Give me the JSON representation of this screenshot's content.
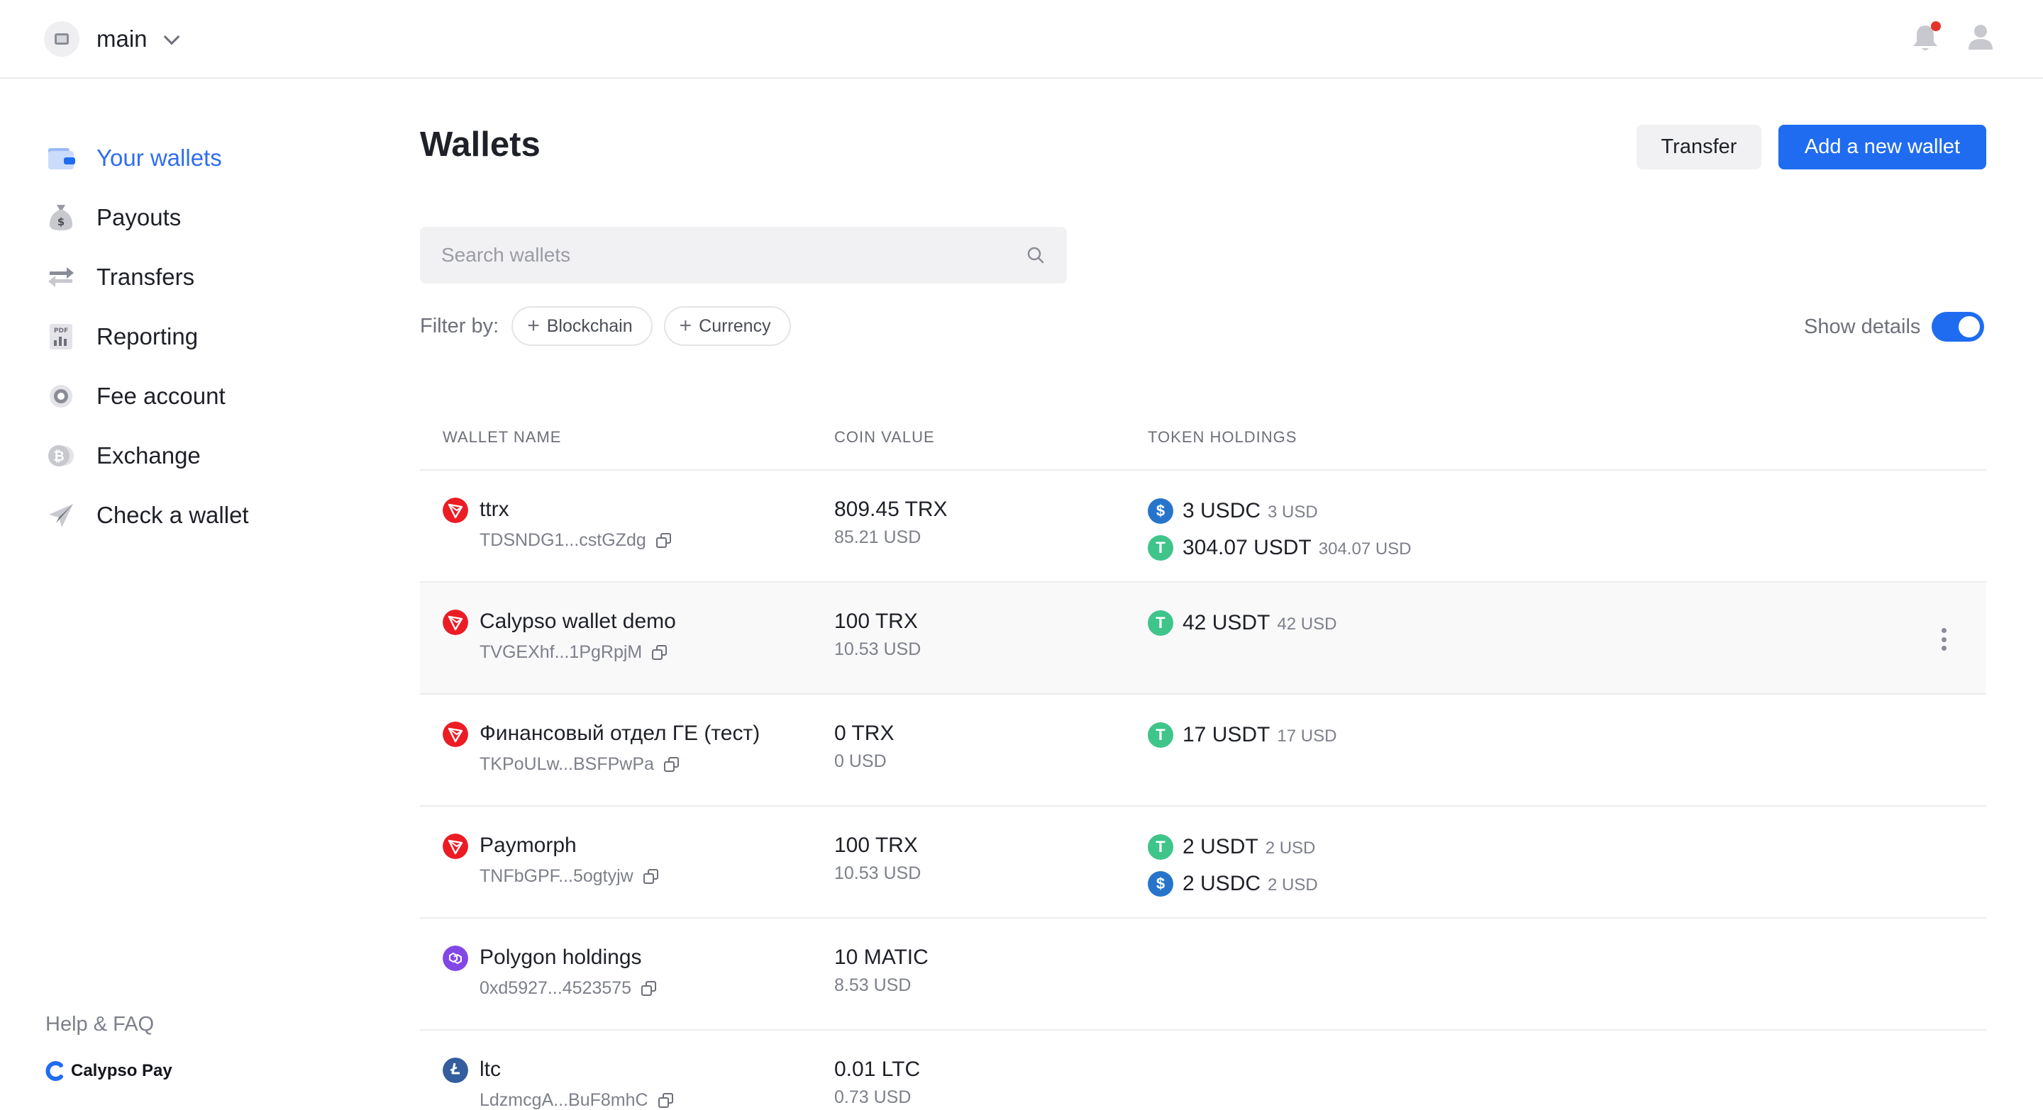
{
  "header": {
    "org_name": "main",
    "icons": {
      "org": "building-icon",
      "notifications": "bell-icon",
      "profile": "user-icon"
    },
    "notification_dot_color": "#e5352b"
  },
  "sidebar": {
    "items": [
      {
        "label": "Your wallets",
        "icon": "wallet-icon",
        "active": true
      },
      {
        "label": "Payouts",
        "icon": "money-bag-icon",
        "active": false
      },
      {
        "label": "Transfers",
        "icon": "arrows-swap-icon",
        "active": false
      },
      {
        "label": "Reporting",
        "icon": "pdf-report-icon",
        "active": false
      },
      {
        "label": "Fee account",
        "icon": "gear-icon",
        "active": false
      },
      {
        "label": "Exchange",
        "icon": "bitcoin-icon",
        "active": false
      },
      {
        "label": "Check a wallet",
        "icon": "plane-icon",
        "active": false
      }
    ],
    "help_label": "Help & FAQ",
    "brand_name": "Calypso Pay"
  },
  "main": {
    "title": "Wallets",
    "transfer_label": "Transfer",
    "add_wallet_label": "Add a new wallet",
    "search_placeholder": "Search wallets",
    "filter_label": "Filter by:",
    "filters": [
      "Blockchain",
      "Currency"
    ],
    "show_details_label": "Show details",
    "show_details_on": true,
    "accent_color": "#1f6cf0"
  },
  "table": {
    "columns": [
      "WALLET NAME",
      "COIN VALUE",
      "TOKEN HOLDINGS"
    ],
    "rows": [
      {
        "name": "ttrx",
        "address": "TDSNDG1...cstGZdg",
        "chain": "tron",
        "coin_value": "809.45 TRX",
        "coin_usd": "85.21 USD",
        "tokens": [
          {
            "amount": "3 USDC",
            "usd": "3 USD",
            "icon": "usdc-icon"
          },
          {
            "amount": "304.07 USDT",
            "usd": "304.07 USD",
            "icon": "usdt-icon"
          }
        ]
      },
      {
        "name": "Calypso wallet demo",
        "address": "TVGEXhf...1PgRpjM",
        "chain": "tron",
        "coin_value": "100 TRX",
        "coin_usd": "10.53 USD",
        "tokens": [
          {
            "amount": "42 USDT",
            "usd": "42 USD",
            "icon": "usdt-icon"
          }
        ]
      },
      {
        "name": "Финансовый отдел ГЕ (тест)",
        "address": "TKPoULw...BSFPwPa",
        "chain": "tron",
        "coin_value": "0 TRX",
        "coin_usd": "0 USD",
        "tokens": [
          {
            "amount": "17 USDT",
            "usd": "17 USD",
            "icon": "usdt-icon"
          }
        ]
      },
      {
        "name": "Paymorph",
        "address": "TNFbGPF...5ogtyjw",
        "chain": "tron",
        "coin_value": "100 TRX",
        "coin_usd": "10.53 USD",
        "tokens": [
          {
            "amount": "2 USDT",
            "usd": "2 USD",
            "icon": "usdt-icon"
          },
          {
            "amount": "2 USDC",
            "usd": "2 USD",
            "icon": "usdc-icon"
          }
        ]
      },
      {
        "name": "Polygon holdings",
        "address": "0xd5927...4523575",
        "chain": "polygon",
        "coin_value": "10 MATIC",
        "coin_usd": "8.53 USD",
        "tokens": []
      },
      {
        "name": "ltc",
        "address": "LdzmcgA...BuF8mhC",
        "chain": "litecoin",
        "coin_value": "0.01 LTC",
        "coin_usd": "0.73 USD",
        "tokens": []
      }
    ]
  }
}
